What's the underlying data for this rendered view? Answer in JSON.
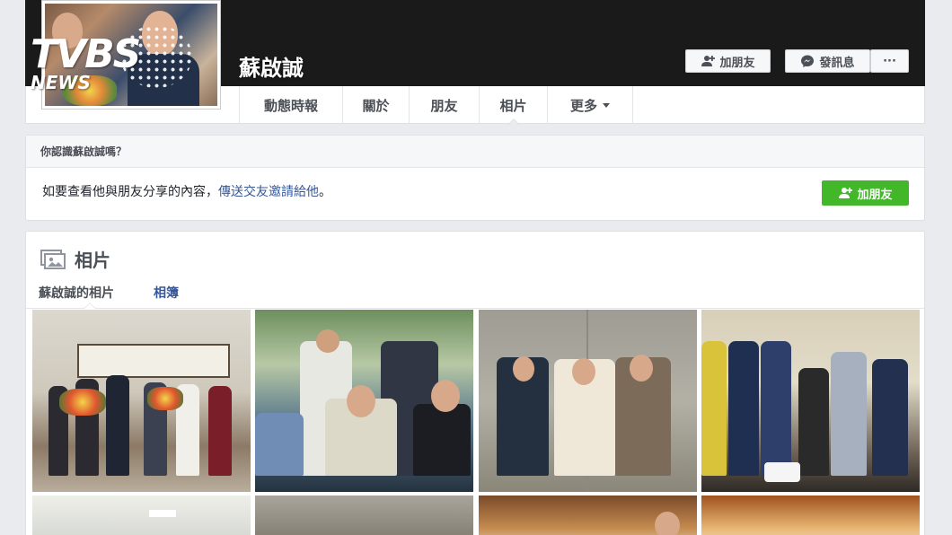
{
  "header": {
    "name": "蘇啟誠",
    "add_friend_label": "加朋友",
    "message_label": "發訊息",
    "more_label": "···"
  },
  "watermark": {
    "brand": "TVBS",
    "sub": "NEWS"
  },
  "tabs": [
    {
      "label": "動態時報"
    },
    {
      "label": "關於"
    },
    {
      "label": "朋友"
    },
    {
      "label": "相片"
    },
    {
      "label": "更多"
    }
  ],
  "know_box": {
    "title": "你認識蘇啟誠嗎？",
    "text": "如要查看他與朋友分享的內容，",
    "link_text": "傳送交友邀請給他",
    "tail": "。",
    "button_label": "加朋友"
  },
  "photos": {
    "title": "相片",
    "subtabs": [
      "蘇啟誠的相片",
      "相簿"
    ]
  },
  "colors": {
    "link": "#365899",
    "green": "#42b72a",
    "cover": "#1a1a1a",
    "bg": "#e9ebee"
  }
}
